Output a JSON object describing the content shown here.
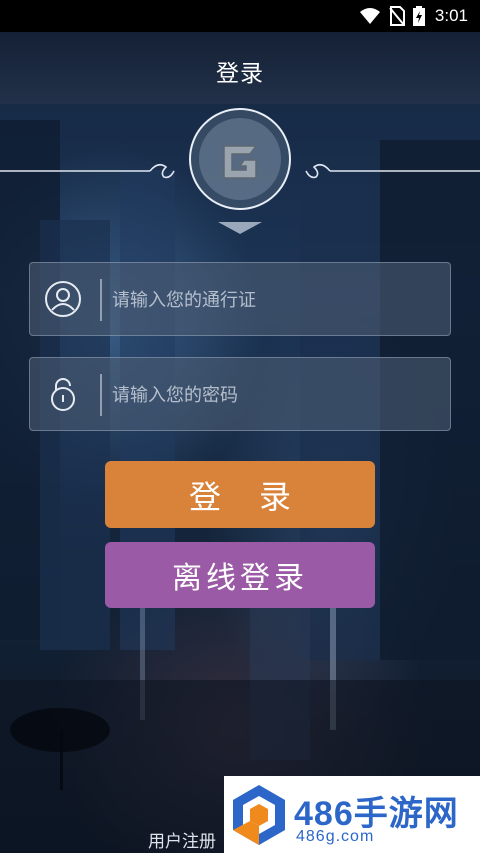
{
  "status_bar": {
    "time": "3:01"
  },
  "header": {
    "title": "登录"
  },
  "form": {
    "username_placeholder": "请输入您的通行证",
    "password_placeholder": "请输入您的密码"
  },
  "buttons": {
    "login_label": "登录",
    "offline_label": "离线登录"
  },
  "footer": {
    "register_label": "用户注册"
  },
  "watermark": {
    "title": "486手游网",
    "subtitle": "486g.com"
  },
  "colors": {
    "login_button": "#d9833a",
    "offline_button": "#9b5aa5",
    "watermark_blue": "#2b66c8",
    "watermark_orange": "#f08a1c"
  },
  "icons": [
    "wifi-icon",
    "no-sim-icon",
    "battery-icon",
    "app-logo-icon",
    "user-icon",
    "lock-icon"
  ]
}
